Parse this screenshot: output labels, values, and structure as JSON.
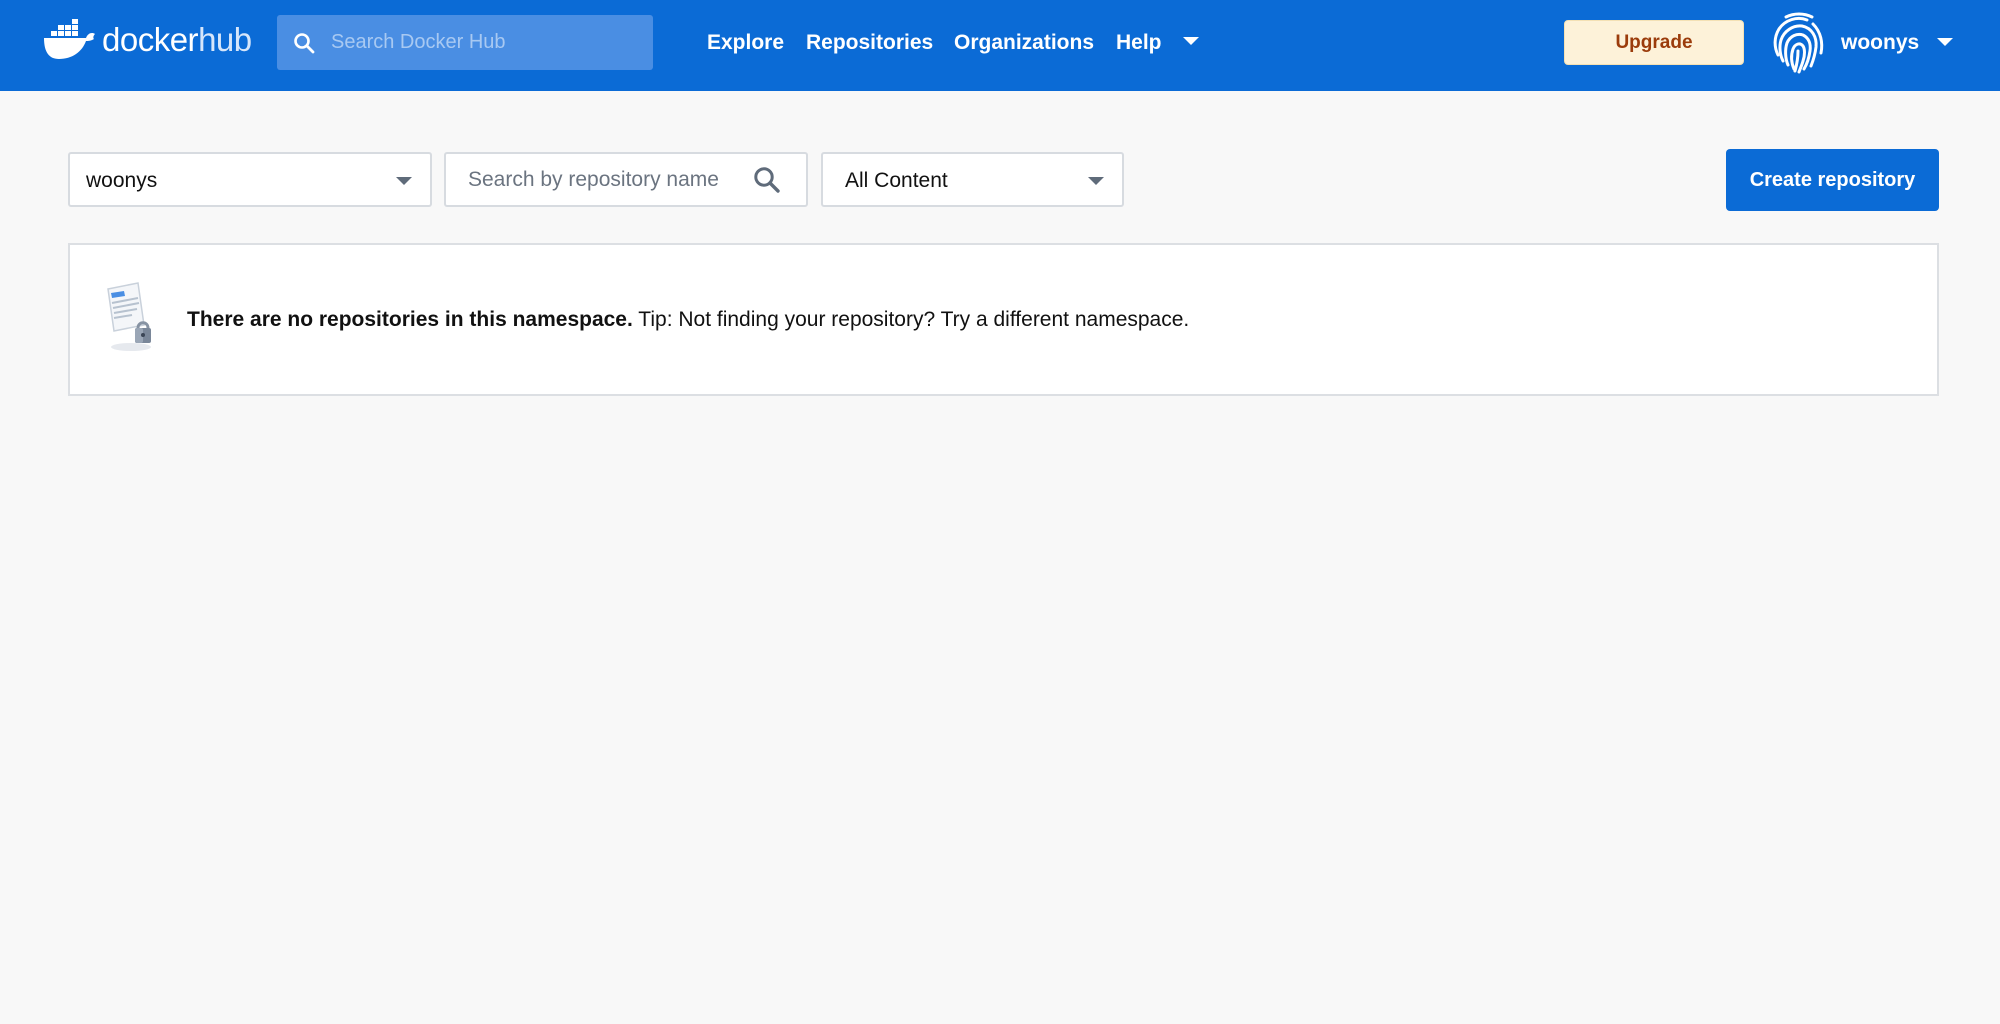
{
  "header": {
    "logo_text_main": "docker",
    "logo_text_sub": "hub",
    "search_placeholder": "Search Docker Hub",
    "nav": {
      "explore": "Explore",
      "repositories": "Repositories",
      "organizations": "Organizations",
      "help": "Help"
    },
    "upgrade_label": "Upgrade",
    "username": "woonys",
    "colors": {
      "bar": "#0b6bd6",
      "upgrade_bg": "#fdf2d9",
      "upgrade_text": "#9b3c0b"
    },
    "icons": [
      "docker-whale-icon",
      "search-icon",
      "caret-down-icon",
      "fingerprint-avatar-icon"
    ]
  },
  "filters": {
    "namespace_value": "woonys",
    "repo_search_placeholder": "Search by repository name",
    "content_filter_value": "All Content",
    "create_label": "Create repository"
  },
  "empty_state": {
    "bold_text": "There are no repositories in this namespace.",
    "tip_text": "Tip: Not finding your repository? Try a different namespace.",
    "icon": "locked-document-icon"
  }
}
